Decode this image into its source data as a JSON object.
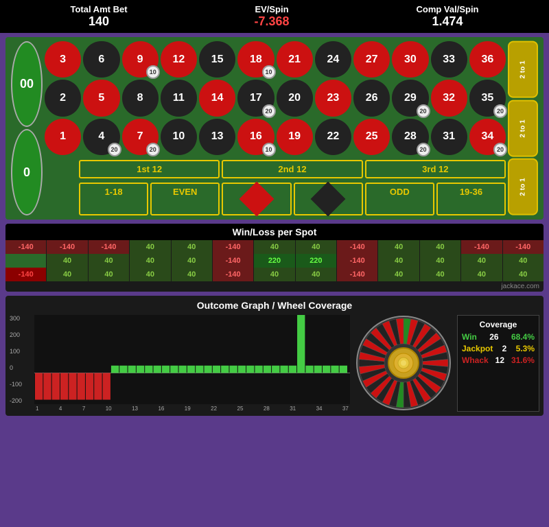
{
  "header": {
    "total_amt_bet_label": "Total Amt Bet",
    "total_amt_bet_value": "140",
    "ev_spin_label": "EV/Spin",
    "ev_spin_value": "-7.368",
    "comp_val_label": "Comp Val/Spin",
    "comp_val_value": "1.474"
  },
  "table": {
    "double_zero": "00",
    "zero": "0",
    "rows": [
      [
        {
          "n": "3",
          "color": "red"
        },
        {
          "n": "6",
          "color": "black"
        },
        {
          "n": "9",
          "color": "red"
        },
        {
          "n": "12",
          "color": "red"
        },
        {
          "n": "15",
          "color": "black"
        },
        {
          "n": "18",
          "color": "red"
        },
        {
          "n": "21",
          "color": "red"
        },
        {
          "n": "24",
          "color": "black"
        },
        {
          "n": "27",
          "color": "red"
        },
        {
          "n": "30",
          "color": "red"
        },
        {
          "n": "33",
          "color": "black"
        },
        {
          "n": "36",
          "color": "red",
          "chip": ""
        }
      ],
      [
        {
          "n": "2",
          "color": "black"
        },
        {
          "n": "5",
          "color": "red"
        },
        {
          "n": "8",
          "color": "black"
        },
        {
          "n": "11",
          "color": "black"
        },
        {
          "n": "14",
          "color": "red"
        },
        {
          "n": "17",
          "color": "black",
          "chip": "20"
        },
        {
          "n": "20",
          "color": "black"
        },
        {
          "n": "23",
          "color": "red"
        },
        {
          "n": "26",
          "color": "black"
        },
        {
          "n": "29",
          "color": "black"
        },
        {
          "n": "32",
          "color": "red"
        },
        {
          "n": "35",
          "color": "black"
        }
      ],
      [
        {
          "n": "1",
          "color": "red"
        },
        {
          "n": "4",
          "color": "black"
        },
        {
          "n": "7",
          "color": "red"
        },
        {
          "n": "10",
          "color": "black"
        },
        {
          "n": "13",
          "color": "black"
        },
        {
          "n": "16",
          "color": "red"
        },
        {
          "n": "19",
          "color": "red"
        },
        {
          "n": "22",
          "color": "black"
        },
        {
          "n": "25",
          "color": "red"
        },
        {
          "n": "28",
          "color": "black"
        },
        {
          "n": "31",
          "color": "black"
        },
        {
          "n": "34",
          "color": "red"
        }
      ]
    ],
    "chips": {
      "12": "10",
      "18_top": "10",
      "21": "",
      "17_mid": "20",
      "2_mid": "",
      "5_mid": "",
      "8_mid": "",
      "20_mid": "20",
      "29_mid": "20",
      "35_mid": "20",
      "16": "10",
      "19": "",
      "1_bot": "",
      "4_bot": "20",
      "7_bot": "20",
      "10_bot": "",
      "28_bot": "20",
      "34_bot": "20"
    },
    "two_to_one": [
      "2 to 1",
      "2 to 1",
      "2 to 1"
    ],
    "dozens": [
      "1st 12",
      "2nd 12",
      "3rd 12"
    ],
    "outside": [
      "1-18",
      "EVEN",
      "RED",
      "BLACK",
      "ODD",
      "19-36"
    ]
  },
  "winloss": {
    "title": "Win/Loss per Spot",
    "rows": [
      [
        "-140",
        "-140",
        "-140",
        "40",
        "40",
        "-140",
        "40",
        "40",
        "-140",
        "40",
        "40",
        "-140",
        "-140"
      ],
      [
        "",
        "40",
        "40",
        "40",
        "40",
        "-140",
        "220",
        "220",
        "-140",
        "40",
        "40",
        "40",
        "40"
      ],
      [
        "-140",
        "40",
        "40",
        "40",
        "40",
        "-140",
        "40",
        "40",
        "-140",
        "40",
        "40",
        "40",
        "40"
      ]
    ],
    "watermark": "jackace.com"
  },
  "graph": {
    "title": "Outcome Graph / Wheel Coverage",
    "y_labels": [
      "300",
      "200",
      "100",
      "0",
      "-100",
      "-200"
    ],
    "x_labels": [
      "1",
      "4",
      "7",
      "10",
      "13",
      "16",
      "19",
      "22",
      "25",
      "28",
      "31",
      "34",
      "37"
    ],
    "bars": [
      {
        "v": -1
      },
      {
        "v": -1
      },
      {
        "v": -1
      },
      {
        "v": -1
      },
      {
        "v": -1
      },
      {
        "v": -1
      },
      {
        "v": -1
      },
      {
        "v": -1
      },
      {
        "v": -1
      },
      {
        "v": 0.2
      },
      {
        "v": 0.2
      },
      {
        "v": 0.2
      },
      {
        "v": 0.2
      },
      {
        "v": 0.2
      },
      {
        "v": 0.2
      },
      {
        "v": 0.2
      },
      {
        "v": 0.2
      },
      {
        "v": 0.2
      },
      {
        "v": 0.2
      },
      {
        "v": 0.2
      },
      {
        "v": 0.2
      },
      {
        "v": 0.2
      },
      {
        "v": 0.2
      },
      {
        "v": 0.2
      },
      {
        "v": 0.2
      },
      {
        "v": 0.2
      },
      {
        "v": 0.2
      },
      {
        "v": 0.2
      },
      {
        "v": 0.2
      },
      {
        "v": 0.2
      },
      {
        "v": 0.2
      },
      {
        "v": 1.5
      },
      {
        "v": 0.2
      },
      {
        "v": 0.2
      },
      {
        "v": 0.2
      },
      {
        "v": 0.2
      },
      {
        "v": 0.2
      }
    ],
    "coverage": {
      "title": "Coverage",
      "win_label": "Win",
      "win_value": "26",
      "win_pct": "68.4%",
      "jackpot_label": "Jackpot",
      "jackpot_value": "2",
      "jackpot_pct": "5.3%",
      "whack_label": "Whack",
      "whack_value": "12",
      "whack_pct": "31.6%"
    }
  }
}
